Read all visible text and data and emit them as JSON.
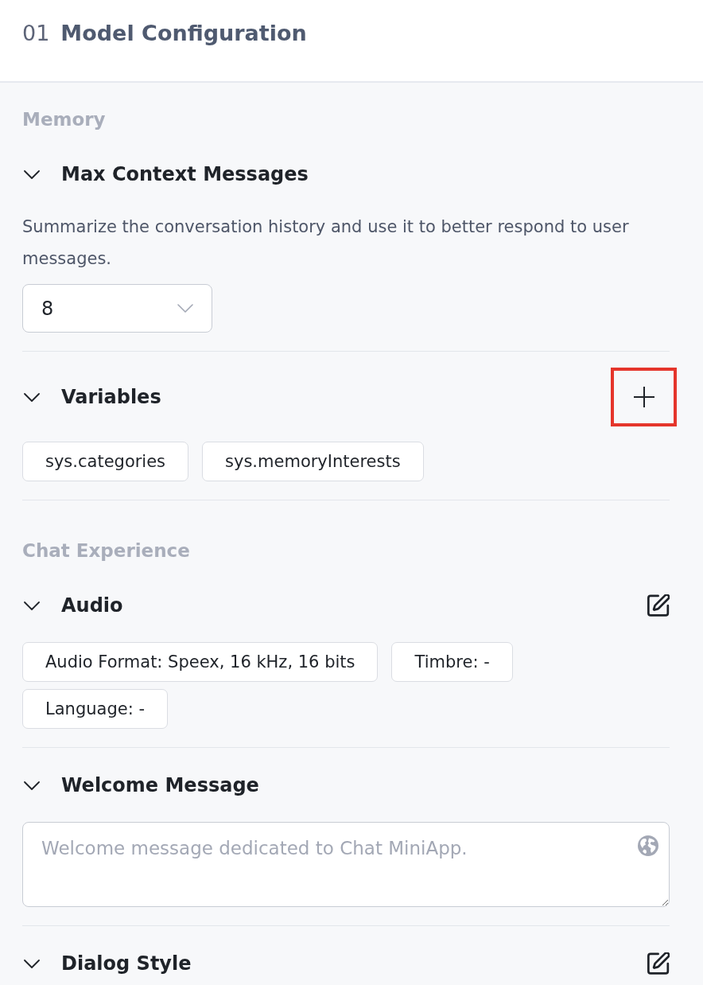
{
  "header": {
    "step": "01",
    "title": "Model Configuration"
  },
  "sections": [
    {
      "label": "Memory",
      "panels": [
        {
          "kind": "select",
          "title": "Max Context Messages",
          "expanded": true,
          "description": "Summarize the conversation history and use it to better respond to user messages.",
          "value": "8"
        },
        {
          "kind": "tags",
          "title": "Variables",
          "expanded": true,
          "action": {
            "kind": "add",
            "highlighted": true
          },
          "tags": [
            "sys.categories",
            "sys.memoryInterests"
          ]
        }
      ]
    },
    {
      "label": "Chat Experience",
      "panels": [
        {
          "kind": "tags",
          "title": "Audio",
          "expanded": true,
          "action": {
            "kind": "edit",
            "highlighted": false
          },
          "tags": [
            "Audio Format: Speex, 16 kHz, 16 bits",
            "Timbre: -",
            "Language: -"
          ]
        },
        {
          "kind": "textarea",
          "title": "Welcome Message",
          "expanded": true,
          "placeholder": "Welcome message dedicated to Chat MiniApp."
        },
        {
          "kind": "plain",
          "title": "Dialog Style",
          "expanded": true,
          "action": {
            "kind": "edit",
            "highlighted": false
          }
        }
      ]
    }
  ]
}
